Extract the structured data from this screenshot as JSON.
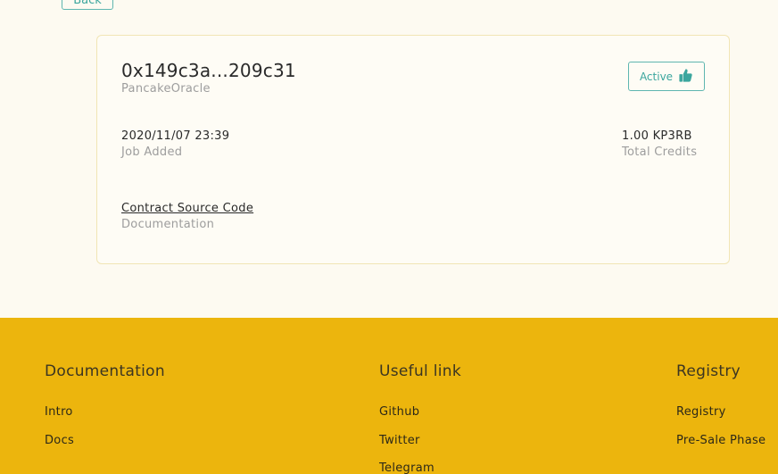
{
  "back_button": {
    "label": "Back"
  },
  "job": {
    "address": "0x149c3a...209c31",
    "name": "PancakeOracle",
    "status": "Active",
    "added_date": "2020/11/07 23:39",
    "added_label": "Job Added",
    "credits": "1.00 KP3RB",
    "credits_label": "Total Credits",
    "source_link": "Contract Source Code",
    "source_label": "Documentation"
  },
  "colors": {
    "accent": "#3ba69e",
    "footer_bg": "#ecb50d",
    "page_bg": "#fdfaf1"
  },
  "footer": {
    "columns": [
      {
        "title": "Documentation",
        "links": [
          "Intro",
          "Docs"
        ]
      },
      {
        "title": "Useful link",
        "links": [
          "Github",
          "Twitter",
          "Telegram"
        ]
      },
      {
        "title": "Registry",
        "links": [
          "Registry",
          "Pre-Sale Phase"
        ]
      }
    ]
  }
}
